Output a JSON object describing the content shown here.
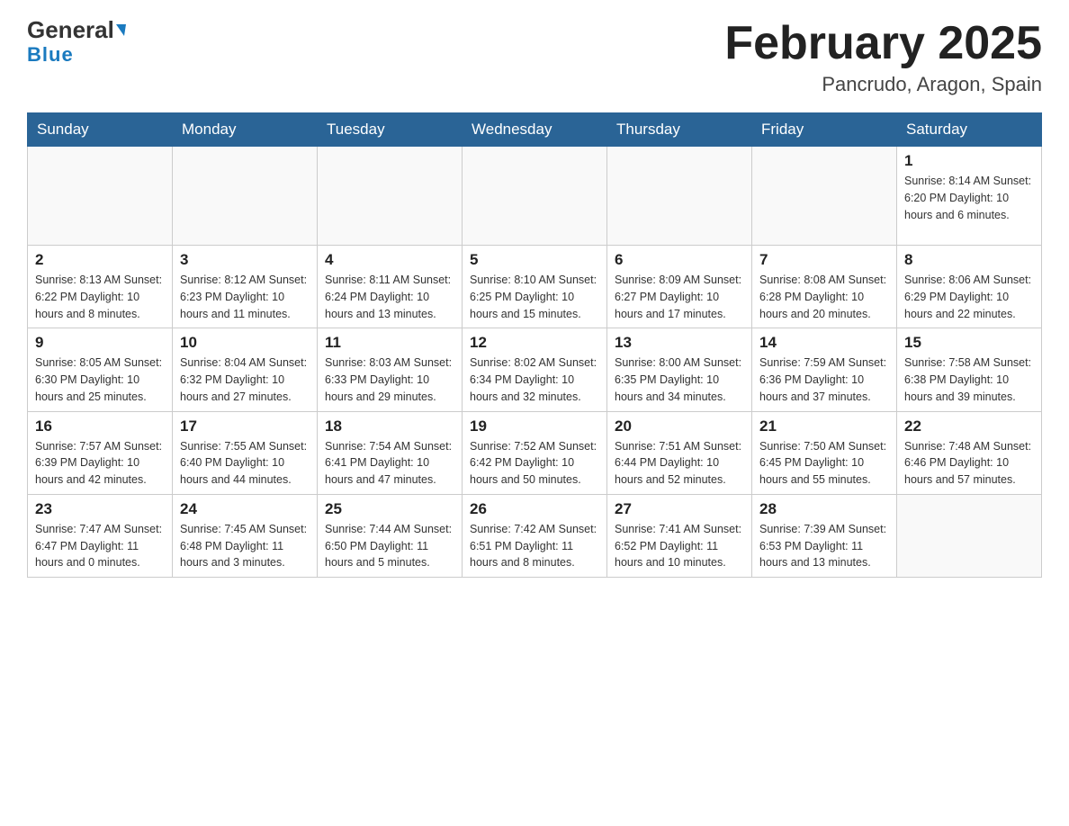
{
  "header": {
    "logo": {
      "general": "General",
      "blue": "Blue"
    },
    "title": "February 2025",
    "location": "Pancrudo, Aragon, Spain"
  },
  "weekdays": [
    "Sunday",
    "Monday",
    "Tuesday",
    "Wednesday",
    "Thursday",
    "Friday",
    "Saturday"
  ],
  "weeks": [
    [
      {
        "day": "",
        "info": ""
      },
      {
        "day": "",
        "info": ""
      },
      {
        "day": "",
        "info": ""
      },
      {
        "day": "",
        "info": ""
      },
      {
        "day": "",
        "info": ""
      },
      {
        "day": "",
        "info": ""
      },
      {
        "day": "1",
        "info": "Sunrise: 8:14 AM\nSunset: 6:20 PM\nDaylight: 10 hours and 6 minutes."
      }
    ],
    [
      {
        "day": "2",
        "info": "Sunrise: 8:13 AM\nSunset: 6:22 PM\nDaylight: 10 hours and 8 minutes."
      },
      {
        "day": "3",
        "info": "Sunrise: 8:12 AM\nSunset: 6:23 PM\nDaylight: 10 hours and 11 minutes."
      },
      {
        "day": "4",
        "info": "Sunrise: 8:11 AM\nSunset: 6:24 PM\nDaylight: 10 hours and 13 minutes."
      },
      {
        "day": "5",
        "info": "Sunrise: 8:10 AM\nSunset: 6:25 PM\nDaylight: 10 hours and 15 minutes."
      },
      {
        "day": "6",
        "info": "Sunrise: 8:09 AM\nSunset: 6:27 PM\nDaylight: 10 hours and 17 minutes."
      },
      {
        "day": "7",
        "info": "Sunrise: 8:08 AM\nSunset: 6:28 PM\nDaylight: 10 hours and 20 minutes."
      },
      {
        "day": "8",
        "info": "Sunrise: 8:06 AM\nSunset: 6:29 PM\nDaylight: 10 hours and 22 minutes."
      }
    ],
    [
      {
        "day": "9",
        "info": "Sunrise: 8:05 AM\nSunset: 6:30 PM\nDaylight: 10 hours and 25 minutes."
      },
      {
        "day": "10",
        "info": "Sunrise: 8:04 AM\nSunset: 6:32 PM\nDaylight: 10 hours and 27 minutes."
      },
      {
        "day": "11",
        "info": "Sunrise: 8:03 AM\nSunset: 6:33 PM\nDaylight: 10 hours and 29 minutes."
      },
      {
        "day": "12",
        "info": "Sunrise: 8:02 AM\nSunset: 6:34 PM\nDaylight: 10 hours and 32 minutes."
      },
      {
        "day": "13",
        "info": "Sunrise: 8:00 AM\nSunset: 6:35 PM\nDaylight: 10 hours and 34 minutes."
      },
      {
        "day": "14",
        "info": "Sunrise: 7:59 AM\nSunset: 6:36 PM\nDaylight: 10 hours and 37 minutes."
      },
      {
        "day": "15",
        "info": "Sunrise: 7:58 AM\nSunset: 6:38 PM\nDaylight: 10 hours and 39 minutes."
      }
    ],
    [
      {
        "day": "16",
        "info": "Sunrise: 7:57 AM\nSunset: 6:39 PM\nDaylight: 10 hours and 42 minutes."
      },
      {
        "day": "17",
        "info": "Sunrise: 7:55 AM\nSunset: 6:40 PM\nDaylight: 10 hours and 44 minutes."
      },
      {
        "day": "18",
        "info": "Sunrise: 7:54 AM\nSunset: 6:41 PM\nDaylight: 10 hours and 47 minutes."
      },
      {
        "day": "19",
        "info": "Sunrise: 7:52 AM\nSunset: 6:42 PM\nDaylight: 10 hours and 50 minutes."
      },
      {
        "day": "20",
        "info": "Sunrise: 7:51 AM\nSunset: 6:44 PM\nDaylight: 10 hours and 52 minutes."
      },
      {
        "day": "21",
        "info": "Sunrise: 7:50 AM\nSunset: 6:45 PM\nDaylight: 10 hours and 55 minutes."
      },
      {
        "day": "22",
        "info": "Sunrise: 7:48 AM\nSunset: 6:46 PM\nDaylight: 10 hours and 57 minutes."
      }
    ],
    [
      {
        "day": "23",
        "info": "Sunrise: 7:47 AM\nSunset: 6:47 PM\nDaylight: 11 hours and 0 minutes."
      },
      {
        "day": "24",
        "info": "Sunrise: 7:45 AM\nSunset: 6:48 PM\nDaylight: 11 hours and 3 minutes."
      },
      {
        "day": "25",
        "info": "Sunrise: 7:44 AM\nSunset: 6:50 PM\nDaylight: 11 hours and 5 minutes."
      },
      {
        "day": "26",
        "info": "Sunrise: 7:42 AM\nSunset: 6:51 PM\nDaylight: 11 hours and 8 minutes."
      },
      {
        "day": "27",
        "info": "Sunrise: 7:41 AM\nSunset: 6:52 PM\nDaylight: 11 hours and 10 minutes."
      },
      {
        "day": "28",
        "info": "Sunrise: 7:39 AM\nSunset: 6:53 PM\nDaylight: 11 hours and 13 minutes."
      },
      {
        "day": "",
        "info": ""
      }
    ]
  ]
}
